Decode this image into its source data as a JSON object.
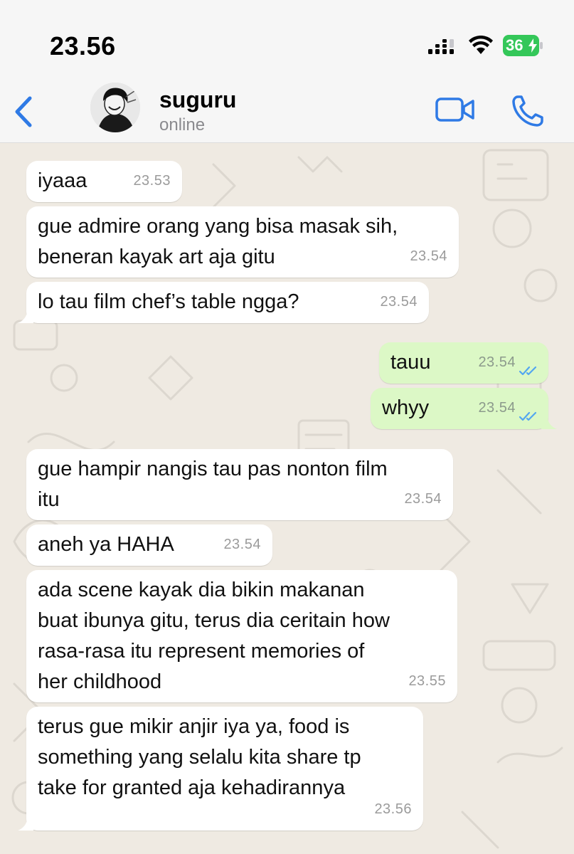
{
  "status_bar": {
    "time": "23.56",
    "battery": "36"
  },
  "header": {
    "contact_name": "suguru",
    "contact_status": "online"
  },
  "messages": [
    {
      "text": "iyaaa",
      "time": "23.53",
      "direction": "in"
    },
    {
      "text": "gue admire orang yang bisa masak sih,\nbeneran kayak art aja gitu",
      "time": "23.54",
      "direction": "in"
    },
    {
      "text": "lo tau film chef’s table ngga?",
      "time": "23.54",
      "direction": "in"
    },
    {
      "text": "tauu",
      "time": "23.54",
      "direction": "out",
      "status": "read"
    },
    {
      "text": "whyy",
      "time": "23.54",
      "direction": "out",
      "status": "read"
    },
    {
      "text": "gue hampir nangis tau pas nonton film\nitu",
      "time": "23.54",
      "direction": "in"
    },
    {
      "text": "aneh ya HAHA",
      "time": "23.54",
      "direction": "in"
    },
    {
      "text": "ada scene kayak dia bikin makanan\nbuat ibunya gitu, terus dia ceritain how\nrasa-rasa itu represent memories of\nher childhood",
      "time": "23.55",
      "direction": "in"
    },
    {
      "text": "terus gue mikir anjir iya ya, food is\nsomething yang selalu kita share tp\ntake for granted aja kehadirannya",
      "time": "23.56",
      "direction": "in"
    }
  ],
  "colors": {
    "accent": "#2f7ae5",
    "incoming_bubble": "#ffffff",
    "outgoing_bubble": "#dcf8c6",
    "read_ticks": "#53a6f0",
    "battery_green": "#34c759"
  }
}
